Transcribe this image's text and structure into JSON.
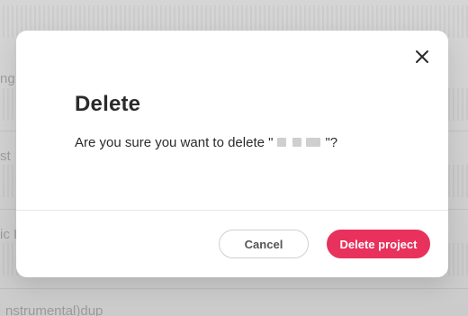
{
  "background": {
    "labels": [
      {
        "text": "ng"
      },
      {
        "text": "st"
      },
      {
        "text": "ic I"
      },
      {
        "text": "nstrumental)dup"
      }
    ]
  },
  "modal": {
    "title": "Delete",
    "message_prefix": "Are you sure you want to delete \"",
    "message_suffix": "\"?",
    "buttons": {
      "cancel": "Cancel",
      "delete": "Delete project"
    }
  },
  "colors": {
    "danger": "#e8315c",
    "text": "#2b2b2b",
    "cancel_border": "#cfcfcf"
  },
  "icons": {
    "close": "close-icon"
  }
}
